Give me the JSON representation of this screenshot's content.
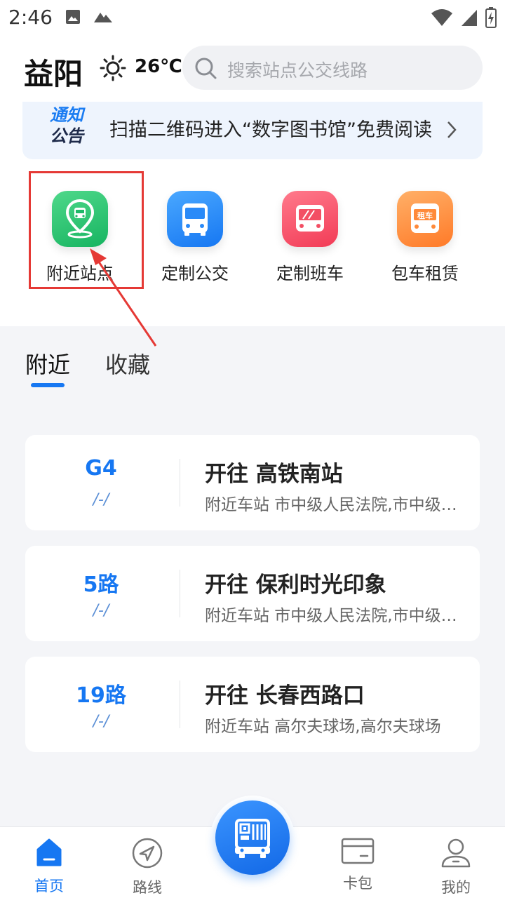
{
  "status_bar": {
    "time": "2:46"
  },
  "header": {
    "city": "益阳",
    "temperature": "26℃",
    "search_placeholder": "搜索站点公交线路"
  },
  "notice": {
    "badge_line1": "通知",
    "badge_line2": "公告",
    "text": "扫描二维码进入“数字图书馆”免费阅读"
  },
  "features": [
    {
      "label": "附近站点",
      "icon": "location-bus-icon"
    },
    {
      "label": "定制公交",
      "icon": "bus-icon"
    },
    {
      "label": "定制班车",
      "icon": "shuttle-bus-icon"
    },
    {
      "label": "包车租赁",
      "icon": "charter-bus-icon",
      "icon_text": "租车"
    }
  ],
  "tabs": [
    {
      "label": "附近"
    },
    {
      "label": "收藏"
    }
  ],
  "routes": [
    {
      "number": "G4",
      "sub": "/-/",
      "destination": "开往 高铁南站",
      "stations": "附近车站 市中级人民法院,市中级人民法院"
    },
    {
      "number": "5路",
      "sub": "/-/",
      "destination": "开往 保利时光印象",
      "stations": "附近车站 市中级人民法院,市中级人民法院"
    },
    {
      "number": "19路",
      "sub": "/-/",
      "destination": "开往 长春西路口",
      "stations": "附近车站 高尔夫球场,高尔夫球场"
    }
  ],
  "bottom_nav": [
    {
      "label": "首页",
      "active": true
    },
    {
      "label": "路线",
      "active": false
    },
    {
      "label": "卡包",
      "active": false
    },
    {
      "label": "我的",
      "active": false
    }
  ],
  "colors": {
    "accent": "#1677f2",
    "highlight": "#e53935"
  }
}
